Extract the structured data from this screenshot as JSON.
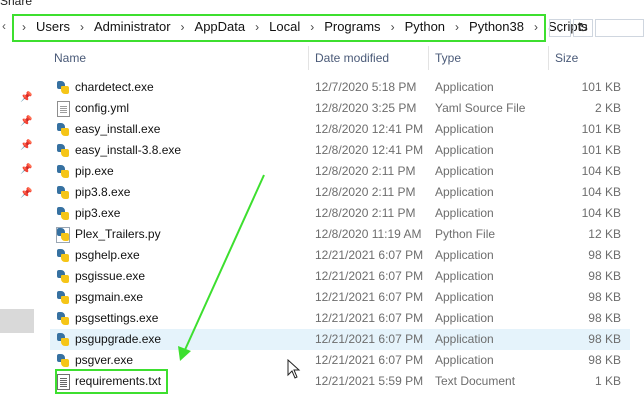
{
  "toolbar": {
    "share_label": "Share"
  },
  "address_bar": {
    "crumbs": [
      "Users",
      "Administrator",
      "AppData",
      "Local",
      "Programs",
      "Python",
      "Python38",
      "Scripts"
    ]
  },
  "columns": {
    "name": "Name",
    "date": "Date modified",
    "type": "Type",
    "size": "Size"
  },
  "files": [
    {
      "name": "chardetect.exe",
      "date": "12/7/2020 5:18 PM",
      "type": "Application",
      "size": "101 KB",
      "icon": "python-exe-icon"
    },
    {
      "name": "config.yml",
      "date": "12/8/2020 3:25 PM",
      "type": "Yaml Source File",
      "size": "2 KB",
      "icon": "document-icon"
    },
    {
      "name": "easy_install.exe",
      "date": "12/8/2020 12:41 PM",
      "type": "Application",
      "size": "101 KB",
      "icon": "python-exe-icon"
    },
    {
      "name": "easy_install-3.8.exe",
      "date": "12/8/2020 12:41 PM",
      "type": "Application",
      "size": "101 KB",
      "icon": "python-exe-icon"
    },
    {
      "name": "pip.exe",
      "date": "12/8/2020 2:11 PM",
      "type": "Application",
      "size": "104 KB",
      "icon": "python-exe-icon"
    },
    {
      "name": "pip3.8.exe",
      "date": "12/8/2020 2:11 PM",
      "type": "Application",
      "size": "104 KB",
      "icon": "python-exe-icon"
    },
    {
      "name": "pip3.exe",
      "date": "12/8/2020 2:11 PM",
      "type": "Application",
      "size": "104 KB",
      "icon": "python-exe-icon"
    },
    {
      "name": "Plex_Trailers.py",
      "date": "12/8/2020 11:19 AM",
      "type": "Python File",
      "size": "12 KB",
      "icon": "python-file-icon"
    },
    {
      "name": "psghelp.exe",
      "date": "12/21/2021 6:07 PM",
      "type": "Application",
      "size": "98 KB",
      "icon": "python-exe-icon"
    },
    {
      "name": "psgissue.exe",
      "date": "12/21/2021 6:07 PM",
      "type": "Application",
      "size": "98 KB",
      "icon": "python-exe-icon"
    },
    {
      "name": "psgmain.exe",
      "date": "12/21/2021 6:07 PM",
      "type": "Application",
      "size": "98 KB",
      "icon": "python-exe-icon"
    },
    {
      "name": "psgsettings.exe",
      "date": "12/21/2021 6:07 PM",
      "type": "Application",
      "size": "98 KB",
      "icon": "python-exe-icon"
    },
    {
      "name": "psgupgrade.exe",
      "date": "12/21/2021 6:07 PM",
      "type": "Application",
      "size": "98 KB",
      "icon": "python-exe-icon"
    },
    {
      "name": "psgver.exe",
      "date": "12/21/2021 6:07 PM",
      "type": "Application",
      "size": "98 KB",
      "icon": "python-exe-icon"
    },
    {
      "name": "requirements.txt",
      "date": "12/21/2021 5:59 PM",
      "type": "Text Document",
      "size": "1 KB",
      "icon": "text-document-icon"
    }
  ],
  "colors": {
    "annotation": "#3ddf2f",
    "hover_row": "#e5f3fb",
    "header_text": "#4a5a78"
  }
}
